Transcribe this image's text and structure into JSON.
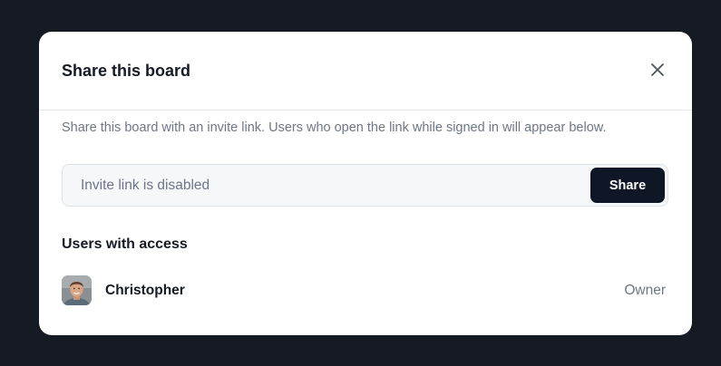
{
  "dialog": {
    "title": "Share this board",
    "close_icon": "close-icon",
    "description": "Share this board with an invite link. Users who open the link while signed in will appear below."
  },
  "invite": {
    "status_text": "Invite link is disabled",
    "share_label": "Share"
  },
  "access": {
    "title": "Users with access",
    "users": [
      {
        "name": "Christopher",
        "role": "Owner",
        "avatar_icon": "user-avatar-photo"
      }
    ]
  },
  "colors": {
    "backdrop": "#161a23",
    "primary_button": "#0f1626",
    "muted_text": "#6d7687",
    "heading_text": "#151a26"
  }
}
